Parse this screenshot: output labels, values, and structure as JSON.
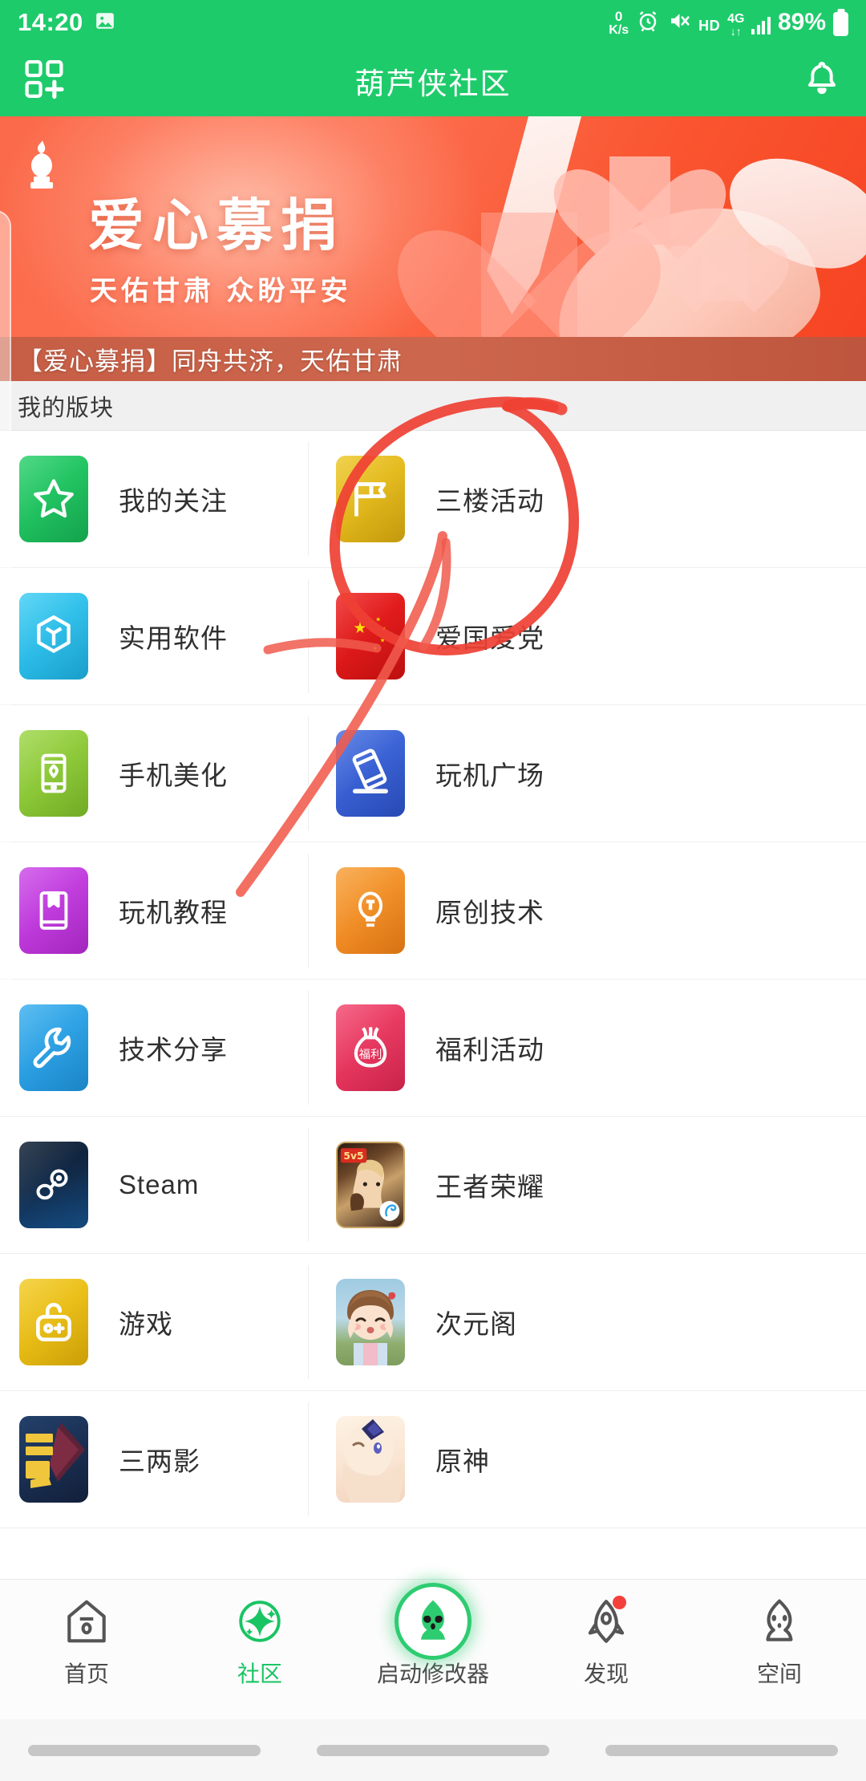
{
  "statusbar": {
    "time": "14:20",
    "network_speed_value": "0",
    "network_speed_unit": "K/s",
    "hd_label": "HD",
    "network_type": "4G",
    "battery_percent": "89%",
    "icons": [
      "image-icon",
      "alarm-icon",
      "mute-icon",
      "hd-icon",
      "data-transfer-icon",
      "signal-icon",
      "battery-icon"
    ]
  },
  "appbar": {
    "title": "葫芦侠社区",
    "left_icon": "qr-scan-add-icon",
    "right_icon": "bell-notification-icon"
  },
  "banner": {
    "logo_icon": "gourd-logo-icon",
    "title": "爱心募捐",
    "subtitle": "天佑甘肃  众盼平安",
    "caption": "【爱心募捐】同舟共济，天佑甘肃",
    "accent_color": "#FA5530"
  },
  "section": {
    "title": "我的版块"
  },
  "grid": {
    "rows": [
      [
        {
          "label": "我的关注",
          "icon": "star-icon",
          "color": "#22C460",
          "kind": "glyph"
        },
        {
          "label": "三楼活动",
          "icon": "flag-icon",
          "color": "#E2B81E",
          "kind": "glyph"
        }
      ],
      [
        {
          "label": "实用软件",
          "icon": "cube-icon",
          "color": "#33C2EB",
          "kind": "glyph"
        },
        {
          "label": "爱国爱党",
          "icon": "china-flag-icon",
          "color": "#E02020",
          "kind": "flag"
        }
      ],
      [
        {
          "label": "手机美化",
          "icon": "phone-beautify-icon",
          "color": "#8CC83C",
          "kind": "glyph"
        },
        {
          "label": "玩机广场",
          "icon": "tilted-phone-icon",
          "color": "#3A63D8",
          "kind": "glyph"
        }
      ],
      [
        {
          "label": "玩机教程",
          "icon": "book-icon",
          "color": "#C13AE0",
          "kind": "glyph"
        },
        {
          "label": "原创技术",
          "icon": "lightbulb-icon",
          "color": "#F08C22",
          "kind": "glyph"
        }
      ],
      [
        {
          "label": "技术分享",
          "icon": "wrench-icon",
          "color": "#2D9FE0",
          "kind": "glyph"
        },
        {
          "label": "福利活动",
          "icon": "money-bag-icon",
          "color": "#ED3B63",
          "kind": "glyph",
          "badge": "福利"
        }
      ],
      [
        {
          "label": "Steam",
          "icon": "steam-logo-icon",
          "color": "#12263F",
          "kind": "steam"
        },
        {
          "label": "王者荣耀",
          "icon": "honor-of-kings-art-icon",
          "color": "#8B5A2B",
          "kind": "art",
          "badge": "5v5"
        }
      ],
      [
        {
          "label": "游戏",
          "icon": "gamepad-icon",
          "color": "#EDBE1A",
          "kind": "glyph"
        },
        {
          "label": "次元阁",
          "icon": "anime-girl-art-icon",
          "color": "#9FC7DE",
          "kind": "art"
        }
      ],
      [
        {
          "label": "三两影",
          "icon": "movie-app-art-icon",
          "color": "#1E3A5F",
          "kind": "art"
        },
        {
          "label": "原神",
          "icon": "genshin-art-icon",
          "color": "#F4E3D0",
          "kind": "art"
        }
      ]
    ]
  },
  "bottomnav": {
    "items": [
      {
        "label": "首页",
        "icon": "home-icon",
        "active": false,
        "badge": false
      },
      {
        "label": "社区",
        "icon": "sparkle-community-icon",
        "active": true,
        "badge": false
      },
      {
        "label": "启动修改器",
        "icon": "modifier-mascot-icon",
        "active": false,
        "badge": false,
        "center": true
      },
      {
        "label": "发现",
        "icon": "rocket-discover-icon",
        "active": false,
        "badge": true
      },
      {
        "label": "空间",
        "icon": "profile-mascot-icon",
        "active": false,
        "badge": false
      }
    ]
  },
  "annotation": {
    "color": "#EF4034",
    "shapes": [
      "hand-drawn-circle-around-三楼活动",
      "hand-drawn-arrow-pointing-up-left",
      "hand-drawn-stroke"
    ]
  }
}
